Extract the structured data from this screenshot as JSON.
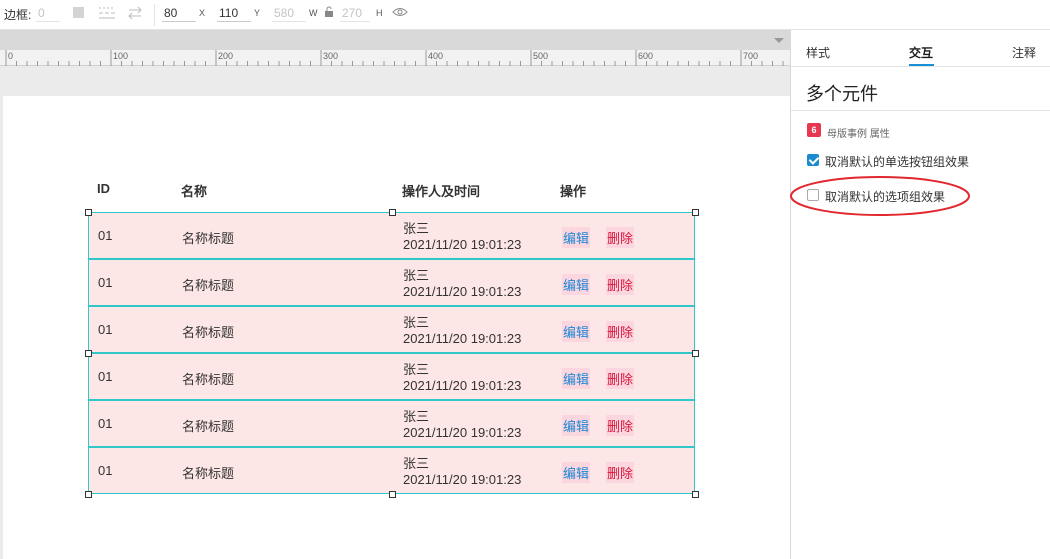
{
  "toolbar": {
    "border_label": "边框:",
    "border_value": "0",
    "x_value": "80",
    "x_suffix": "X",
    "y_value": "110",
    "y_suffix": "Y",
    "w_value": "580",
    "w_suffix": "W",
    "h_value": "270",
    "h_suffix": "H"
  },
  "ruler": {
    "ticks": [
      "0",
      "100",
      "200",
      "300",
      "400",
      "500",
      "600",
      "700"
    ]
  },
  "table": {
    "headers": {
      "id": "ID",
      "name": "名称",
      "operator": "操作人及时间",
      "actions": "操作"
    },
    "rows": [
      {
        "id": "01",
        "name": "名称标题",
        "operator": "张三",
        "time": "2021/11/20 19:01:23",
        "edit": "编辑",
        "delete": "删除"
      },
      {
        "id": "01",
        "name": "名称标题",
        "operator": "张三",
        "time": "2021/11/20 19:01:23",
        "edit": "编辑",
        "delete": "删除"
      },
      {
        "id": "01",
        "name": "名称标题",
        "operator": "张三",
        "time": "2021/11/20 19:01:23",
        "edit": "编辑",
        "delete": "删除"
      },
      {
        "id": "01",
        "name": "名称标题",
        "operator": "张三",
        "time": "2021/11/20 19:01:23",
        "edit": "编辑",
        "delete": "删除"
      },
      {
        "id": "01",
        "name": "名称标题",
        "operator": "张三",
        "time": "2021/11/20 19:01:23",
        "edit": "编辑",
        "delete": "删除"
      },
      {
        "id": "01",
        "name": "名称标题",
        "operator": "张三",
        "time": "2021/11/20 19:01:23",
        "edit": "编辑",
        "delete": "删除"
      }
    ]
  },
  "panel": {
    "tabs": [
      "样式",
      "交互",
      "注释"
    ],
    "active_tab": "交互",
    "title": "多个元件",
    "badge": "6",
    "badge_text": "母版事例 属性",
    "options": [
      {
        "label": "取消默认的单选按钮组效果",
        "checked": true
      },
      {
        "label": "取消默认的选项组效果",
        "checked": false
      }
    ]
  },
  "colors": {
    "accent": "#1890d6",
    "row_bg": "#fde6e6",
    "row_border": "#2fc7c7",
    "delete": "#d9143c",
    "badge": "#e8384f",
    "annotation": "#e0282e"
  }
}
